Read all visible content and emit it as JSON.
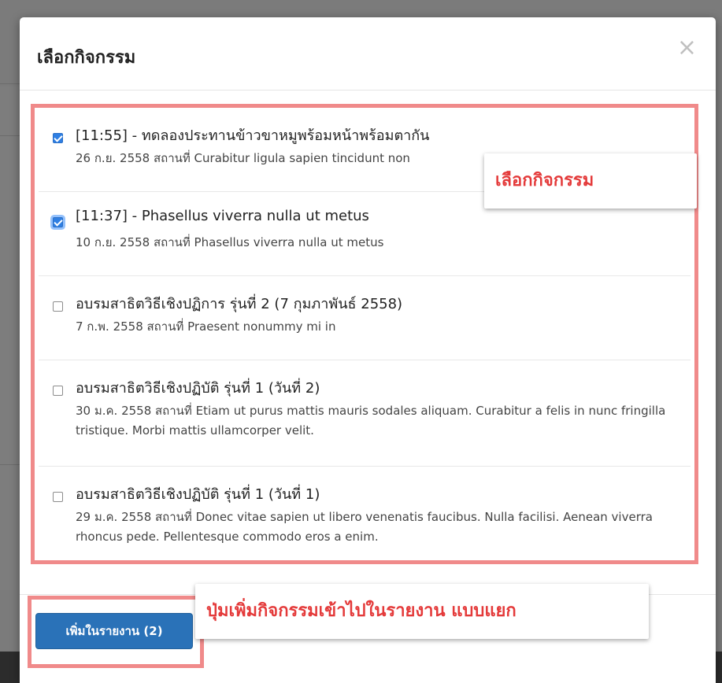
{
  "modal": {
    "title": "เลือกกิจกรรม",
    "close_glyph": "×"
  },
  "activities": [
    {
      "checked": true,
      "title": "[11:55] - ทดลองประทานข้าวขาหมูพร้อมหน้าพร้อมตากัน",
      "detail": "26 ก.ย. 2558 สถานที่ Curabitur ligula sapien tincidunt non"
    },
    {
      "checked": true,
      "title": "[11:37] - Phasellus viverra nulla ut metus",
      "detail": "10 ก.ย. 2558 สถานที่ Phasellus viverra nulla ut metus"
    },
    {
      "checked": false,
      "title": "อบรมสาธิตวิธีเชิงปฏิการ รุ่นที่ 2 (7 กุมภาพันธ์ 2558)",
      "detail": "7 ก.พ. 2558 สถานที่ Praesent nonummy mi in"
    },
    {
      "checked": false,
      "title": "อบรมสาธิตวิธีเชิงปฏิบัติ รุ่นที่ 1 (วันที่ 2)",
      "detail": "30 ม.ค. 2558 สถานที่ Etiam ut purus mattis mauris sodales aliquam. Curabitur a felis in nunc fringilla tristique. Morbi mattis ullamcorper velit."
    },
    {
      "checked": false,
      "title": "อบรมสาธิตวิธีเชิงปฏิบัติ รุ่นที่ 1 (วันที่ 1)",
      "detail": "29 ม.ค. 2558 สถานที่ Donec vitae sapien ut libero venenatis faucibus. Nulla facilisi. Aenean viverra rhoncus pede. Pellentesque commodo eros a enim."
    }
  ],
  "footer": {
    "add_button_label": "เพิ่มในรายงาน (2)"
  },
  "annotations": {
    "select_callout": "เลือกกิจกรรม",
    "add_callout": "ปุ่มเพิ่มกิจกรรมเข้าไปในรายงาน แบบแยก"
  },
  "colors": {
    "highlight_border": "#f08a8a",
    "callout_text": "#e43a3a",
    "primary_button": "#2a72b8",
    "checkbox_checked": "#2f7fe3"
  }
}
